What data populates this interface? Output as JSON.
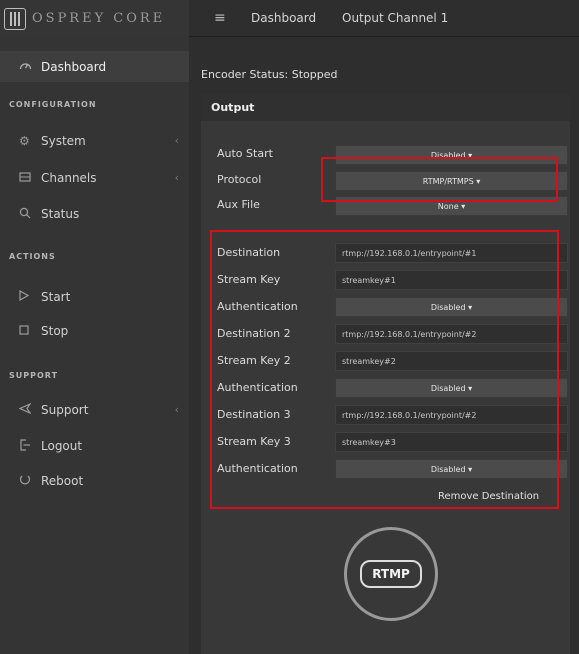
{
  "app": {
    "brand": "OSPREY CORE"
  },
  "topbar": {
    "menu_icon": "≡",
    "crumbs": [
      "Dashboard",
      "Output Channel 1"
    ]
  },
  "sidebar": {
    "dashboard": "Dashboard",
    "section_configuration": "CONFIGURATION",
    "system": "System",
    "channels": "Channels",
    "status": "Status",
    "section_actions": "ACTIONS",
    "start": "Start",
    "stop": "Stop",
    "section_support": "SUPPORT",
    "support": "Support",
    "logout": "Logout",
    "reboot": "Reboot",
    "chev": "‹"
  },
  "main": {
    "encoder_status": "Encoder Status:  Stopped",
    "panel_title": "Output",
    "auto_start": {
      "label": "Auto Start",
      "value": "Disabled ▾"
    },
    "protocol": {
      "label": "Protocol",
      "value": "RTMP/RTMPS ▾"
    },
    "aux_file": {
      "label": "Aux File",
      "value": "None ▾"
    },
    "destinations": [
      {
        "dest_label": "Destination",
        "dest_value": "rtmp://192.168.0.1/entrypoint/#1",
        "key_label": "Stream Key",
        "key_value": "streamkey#1",
        "auth_label": "Authentication",
        "auth_value": "Disabled ▾"
      },
      {
        "dest_label": "Destination 2",
        "dest_value": "rtmp://192.168.0.1/entrypoint/#2",
        "key_label": "Stream Key 2",
        "key_value": "streamkey#2",
        "auth_label": "Authentication",
        "auth_value": "Disabled ▾"
      },
      {
        "dest_label": "Destination 3",
        "dest_value": "rtmp://192.168.0.1/entrypoint/#2",
        "key_label": "Stream Key 3",
        "key_value": "streamkey#3",
        "auth_label": "Authentication",
        "auth_value": "Disabled ▾"
      }
    ],
    "remove_destination": "Remove Destination",
    "rtmp_button": "RTMP"
  },
  "icons": {
    "dashboard": "dashboard-gauge-icon",
    "system": "gear-icon",
    "channels": "channels-icon",
    "status": "search-icon",
    "start": "play-icon",
    "stop": "stop-icon",
    "support": "send-icon",
    "logout": "logout-icon",
    "reboot": "reboot-icon"
  },
  "colors": {
    "highlight": "#d4101a",
    "sidebar_bg": "#343434",
    "panel_bg": "#383838"
  }
}
